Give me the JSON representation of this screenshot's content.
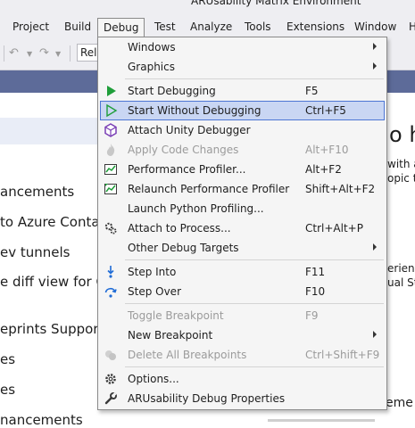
{
  "window": {
    "title": "ARUsability Matrix Environment"
  },
  "menubar": {
    "items": [
      "Project",
      "Build",
      "Debug",
      "Test",
      "Analyze",
      "Tools",
      "Extensions",
      "Window",
      "H"
    ]
  },
  "toolbar": {
    "config_value": "Rel"
  },
  "background": {
    "left_lines": [
      "ancements",
      "to Azure Contai",
      "ev tunnels",
      "e diff view for C#",
      "eprints Support",
      "es",
      "es",
      "nancements"
    ],
    "right_heading": "o ha",
    "right_lines": [
      "with ar",
      "opic t",
      "erience",
      "ual Stu",
      "eme"
    ]
  },
  "debug_menu": {
    "items": [
      {
        "label": "Windows",
        "shortcut": "",
        "submenu": true,
        "icon": "",
        "disabled": false
      },
      {
        "label": "Graphics",
        "shortcut": "",
        "submenu": true,
        "icon": "",
        "disabled": false
      },
      {
        "label": "Start Debugging",
        "shortcut": "F5",
        "submenu": false,
        "icon": "play-filled-icon",
        "disabled": false
      },
      {
        "label": "Start Without Debugging",
        "shortcut": "Ctrl+F5",
        "submenu": false,
        "icon": "play-outline-icon",
        "disabled": false
      },
      {
        "label": "Attach Unity Debugger",
        "shortcut": "",
        "submenu": false,
        "icon": "unity-cube-icon",
        "disabled": false
      },
      {
        "label": "Apply Code Changes",
        "shortcut": "Alt+F10",
        "submenu": false,
        "icon": "hot-reload-flame-icon",
        "disabled": true
      },
      {
        "label": "Performance Profiler...",
        "shortcut": "Alt+F2",
        "submenu": false,
        "icon": "profiler-chart-icon",
        "disabled": false
      },
      {
        "label": "Relaunch Performance Profiler",
        "shortcut": "Shift+Alt+F2",
        "submenu": false,
        "icon": "profiler-relaunch-icon",
        "disabled": false
      },
      {
        "label": "Launch Python Profiling...",
        "shortcut": "",
        "submenu": false,
        "icon": "",
        "disabled": false
      },
      {
        "label": "Attach to Process...",
        "shortcut": "Ctrl+Alt+P",
        "submenu": false,
        "icon": "attach-process-gears-icon",
        "disabled": false
      },
      {
        "label": "Other Debug Targets",
        "shortcut": "",
        "submenu": true,
        "icon": "",
        "disabled": false
      },
      {
        "label": "Step Into",
        "shortcut": "F11",
        "submenu": false,
        "icon": "step-into-icon",
        "disabled": false
      },
      {
        "label": "Step Over",
        "shortcut": "F10",
        "submenu": false,
        "icon": "step-over-icon",
        "disabled": false
      },
      {
        "label": "Toggle Breakpoint",
        "shortcut": "F9",
        "submenu": false,
        "icon": "",
        "disabled": true
      },
      {
        "label": "New Breakpoint",
        "shortcut": "",
        "submenu": true,
        "icon": "",
        "disabled": false
      },
      {
        "label": "Delete All Breakpoints",
        "shortcut": "Ctrl+Shift+F9",
        "submenu": false,
        "icon": "delete-breakpoints-icon",
        "disabled": true
      },
      {
        "label": "Options...",
        "shortcut": "",
        "submenu": false,
        "icon": "options-gear-icon",
        "disabled": false
      },
      {
        "label": "ARUsability Debug Properties",
        "shortcut": "",
        "submenu": false,
        "icon": "wrench-icon",
        "disabled": false
      }
    ],
    "highlighted_index": 3
  },
  "colors": {
    "chrome": "#eeeef2",
    "tab_strip": "#5d6b99",
    "menu_bg": "#f5f5f5",
    "highlight_bg": "#c9d6f3",
    "highlight_border": "#4d76d4",
    "play_green": "#1f9e3a",
    "disabled_text": "#9b9b9b"
  }
}
